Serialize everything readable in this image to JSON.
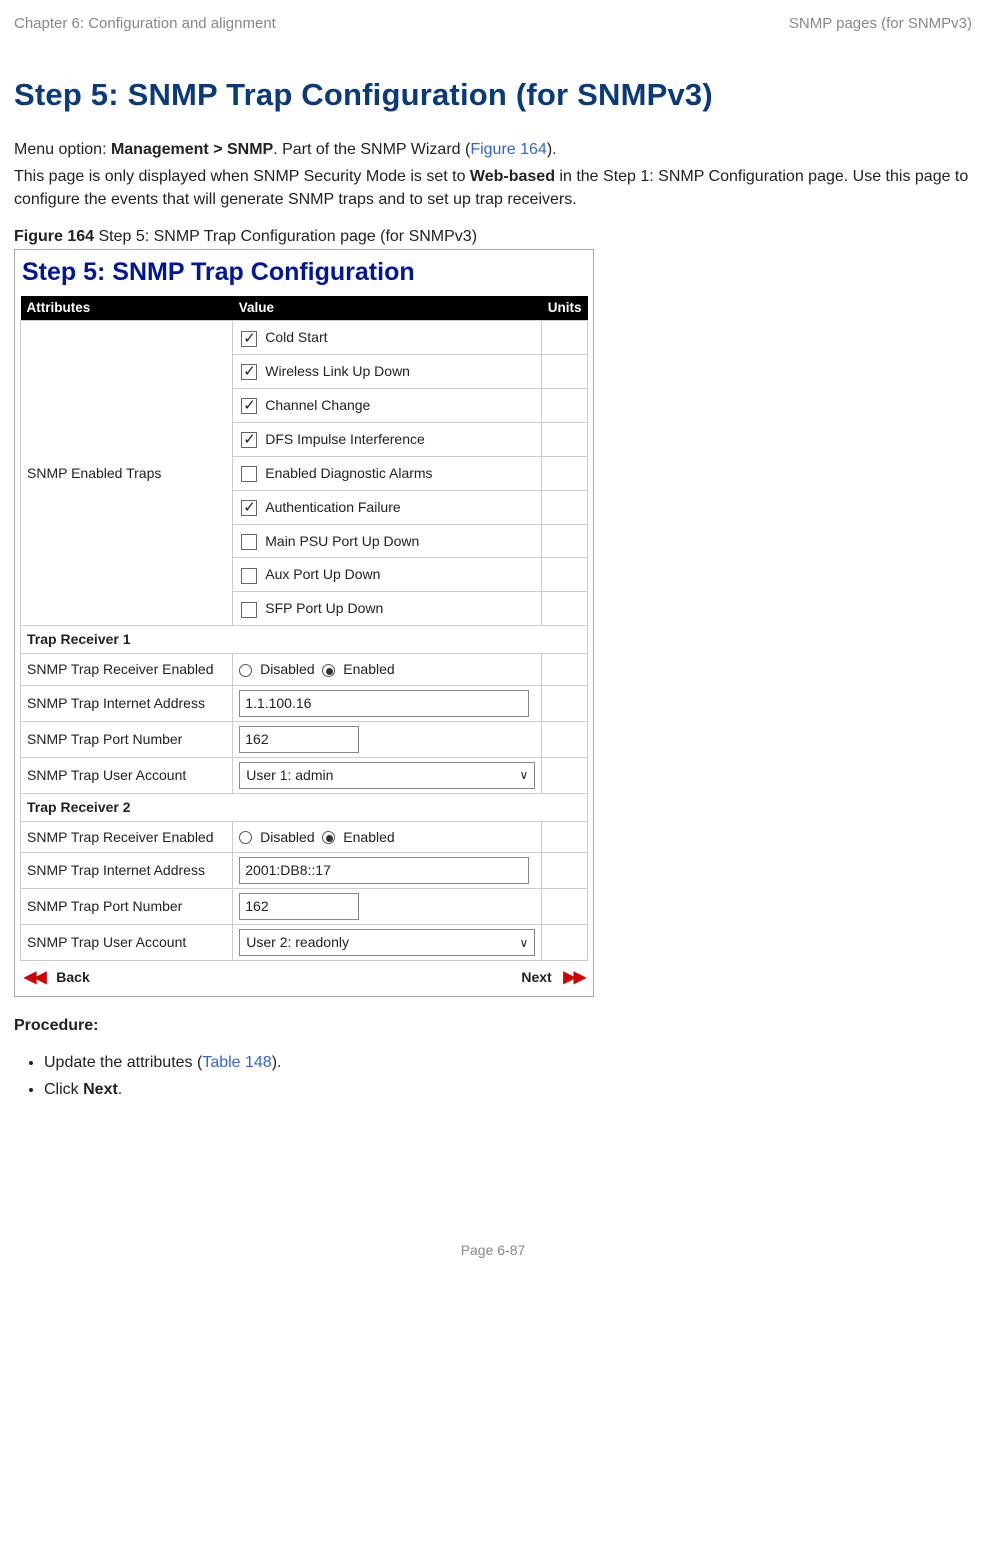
{
  "header": {
    "left": "Chapter 6:  Configuration and alignment",
    "right": "SNMP pages (for SNMPv3)"
  },
  "title": "Step 5: SNMP Trap Configuration (for SNMPv3)",
  "intro": {
    "menu_prefix": "Menu option: ",
    "menu_path": "Management > SNMP",
    "wizard_text": ". Part of the SNMP Wizard (",
    "figure_ref": "Figure 164",
    "wizard_close": ").",
    "para2_a": "This page is only displayed when SNMP Security Mode is set to ",
    "para2_bold": "Web-based",
    "para2_b": " in the Step 1: SNMP Configuration page. Use this page to configure the events that will generate SNMP traps and to set up trap receivers."
  },
  "figure": {
    "label_bold": "Figure 164",
    "label_rest": "  Step 5: SNMP Trap Configuration page (for SNMPv3)",
    "title": "Step 5: SNMP Trap Configuration",
    "headers": {
      "attr": "Attributes",
      "val": "Value",
      "units": "Units"
    },
    "traps_label": "SNMP Enabled Traps",
    "traps": [
      {
        "label": "Cold Start",
        "checked": true
      },
      {
        "label": "Wireless Link Up Down",
        "checked": true
      },
      {
        "label": "Channel Change",
        "checked": true
      },
      {
        "label": "DFS Impulse Interference",
        "checked": true
      },
      {
        "label": "Enabled Diagnostic Alarms",
        "checked": false
      },
      {
        "label": "Authentication Failure",
        "checked": true
      },
      {
        "label": "Main PSU Port Up Down",
        "checked": false
      },
      {
        "label": "Aux Port Up Down",
        "checked": false
      },
      {
        "label": "SFP Port Up Down",
        "checked": false
      }
    ],
    "recv1_title": "Trap Receiver 1",
    "recv2_title": "Trap Receiver 2",
    "row_enabled_label": "SNMP Trap Receiver Enabled",
    "radio_disabled": "Disabled",
    "radio_enabled": "Enabled",
    "row_addr_label": "SNMP Trap Internet Address",
    "row_port_label": "SNMP Trap Port Number",
    "row_user_label": "SNMP Trap User Account",
    "recv1": {
      "addr": "1.1.100.16",
      "port": "162",
      "user": "User 1: admin"
    },
    "recv2": {
      "addr": "2001:DB8::17",
      "port": "162",
      "user": "User 2: readonly"
    },
    "back": "Back",
    "next": "Next"
  },
  "procedure": {
    "heading": "Procedure:",
    "item1_a": "Update the attributes (",
    "item1_link": "Table 148",
    "item1_b": ").",
    "item2_a": "Click ",
    "item2_bold": "Next",
    "item2_b": "."
  },
  "footer": "Page 6-87"
}
